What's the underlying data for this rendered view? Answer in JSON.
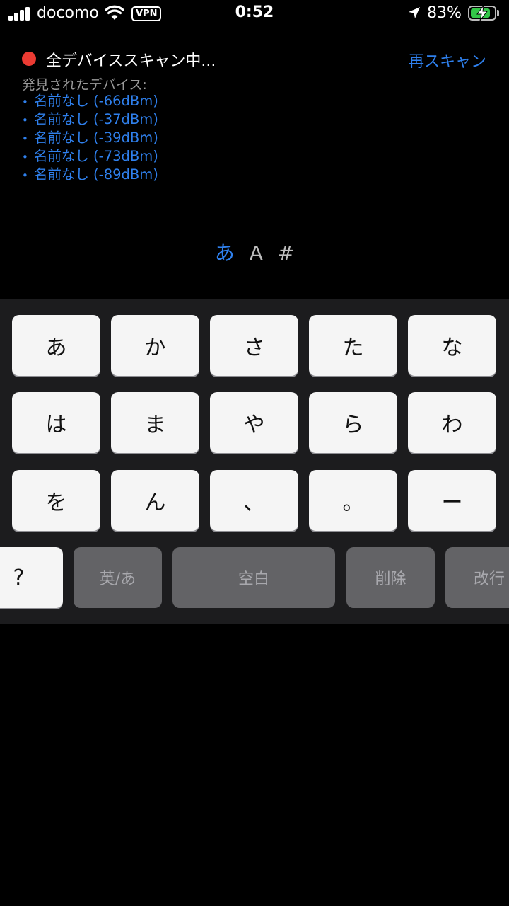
{
  "status_bar": {
    "carrier": "docomo",
    "vpn": "VPN",
    "time": "0:52",
    "battery_percent": "83%"
  },
  "scan": {
    "title": "全デバイススキャン中...",
    "rescan_label": "再スキャン",
    "found_label": "発見されたデバイス:",
    "devices": [
      "名前なし (-66dBm)",
      "名前なし (-37dBm)",
      "名前なし (-39dBm)",
      "名前なし (-73dBm)",
      "名前なし (-89dBm)"
    ]
  },
  "input_modes": {
    "active": "あ",
    "items": [
      "あ",
      "A",
      "#"
    ]
  },
  "keyboard": {
    "rows": [
      [
        "あ",
        "か",
        "さ",
        "た",
        "な"
      ],
      [
        "は",
        "ま",
        "や",
        "ら",
        "わ"
      ],
      [
        "を",
        "ん",
        "、",
        "。",
        "ー"
      ]
    ],
    "bottom": {
      "question": "?",
      "toggle": "英/あ",
      "space": "空白",
      "delete": "削除",
      "enter": "改行"
    }
  },
  "colors": {
    "accent": "#2f80ed",
    "recording": "#eb3b33",
    "battery": "#33c748"
  }
}
